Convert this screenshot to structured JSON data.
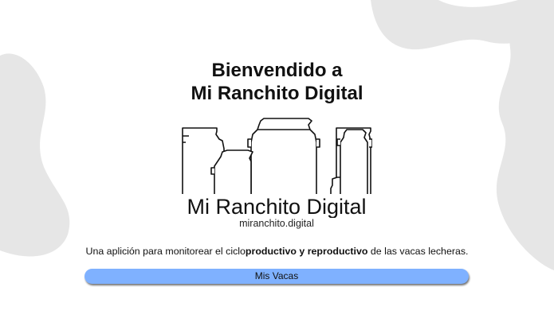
{
  "welcome": {
    "line1": "Bienvendido a",
    "line2": "Mi Ranchito Digital"
  },
  "logo": {
    "name": "Mi Ranchito Digital",
    "domain": "miranchito.digital"
  },
  "description": {
    "before": "Una aplición para monitorear el ciclo",
    "bold": "productivo y reproductivo",
    "after": " de las vacas lecheras."
  },
  "buttons": {
    "mis_vacas": "Mis Vacas"
  },
  "colors": {
    "button": "#7fb1ff",
    "background_spots": "#e6e6e6"
  },
  "icons": {
    "logo_art": "milk-cans-icon"
  }
}
